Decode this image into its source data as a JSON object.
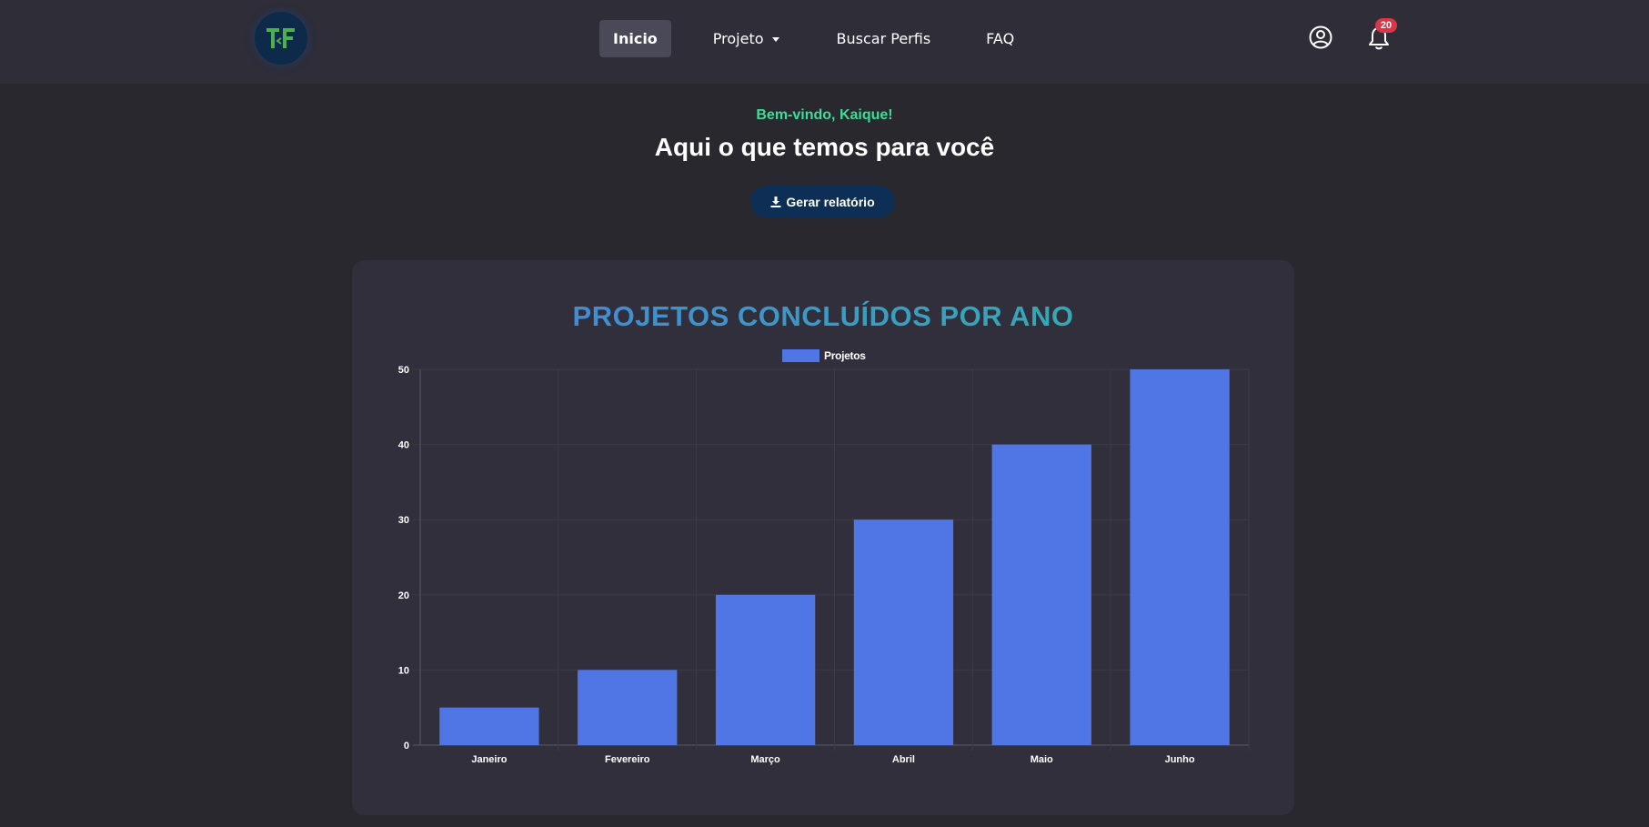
{
  "nav": {
    "logo_text": "TF",
    "links": [
      {
        "label": "Inicio",
        "active": true
      },
      {
        "label": "Projeto",
        "dropdown": true
      },
      {
        "label": "Buscar Perfis"
      },
      {
        "label": "FAQ"
      }
    ],
    "notification_count": "20",
    "icons": [
      "user-circle-icon",
      "bell-icon"
    ]
  },
  "hero": {
    "welcome": "Bem-vindo, Kaique!",
    "headline": "Aqui o que temos para você",
    "report_button": "Gerar relatório"
  },
  "colors": {
    "accent_green": "#3ddc97",
    "bar": "#5076e6",
    "badge": "#dc3545",
    "button": "#0e2f55"
  },
  "chart_data": {
    "type": "bar",
    "title": "PROJETOS CONCLUÍDOS POR ANO",
    "categories": [
      "Janeiro",
      "Fevereiro",
      "Março",
      "Abril",
      "Maio",
      "Junho"
    ],
    "series": [
      {
        "name": "Projetos",
        "values": [
          5,
          10,
          20,
          30,
          40,
          50
        ]
      }
    ],
    "ylim": [
      0,
      50
    ],
    "yticks": [
      0,
      10,
      20,
      30,
      40,
      50
    ],
    "grid": true,
    "legend": "top-center"
  }
}
